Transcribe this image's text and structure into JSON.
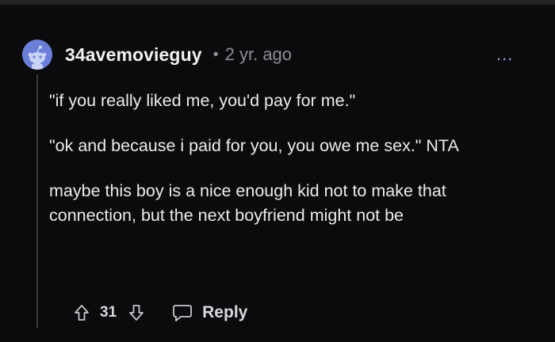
{
  "comment": {
    "username": "34avemovieguy",
    "separator": "•",
    "time_ago": "2 yr. ago",
    "more_label": "...",
    "paragraphs": [
      "\"if you really liked me, you'd pay for me.\"",
      "\"ok and because i paid for you, you owe me sex.\" NTA",
      "maybe this boy is a nice enough kid not to make that connection, but the next boyfriend might not be"
    ],
    "vote_count": "31",
    "reply_label": "Reply",
    "icons": {
      "avatar": "reddit-snoo-avatar",
      "upvote": "arrow-up-icon",
      "downvote": "arrow-down-icon",
      "reply": "speech-bubble-icon",
      "more": "more-dots-icon"
    }
  },
  "colors": {
    "background": "#0b0b0d",
    "avatar": "#6b7fd8",
    "text": "#ececee",
    "muted": "#8e8e93"
  }
}
